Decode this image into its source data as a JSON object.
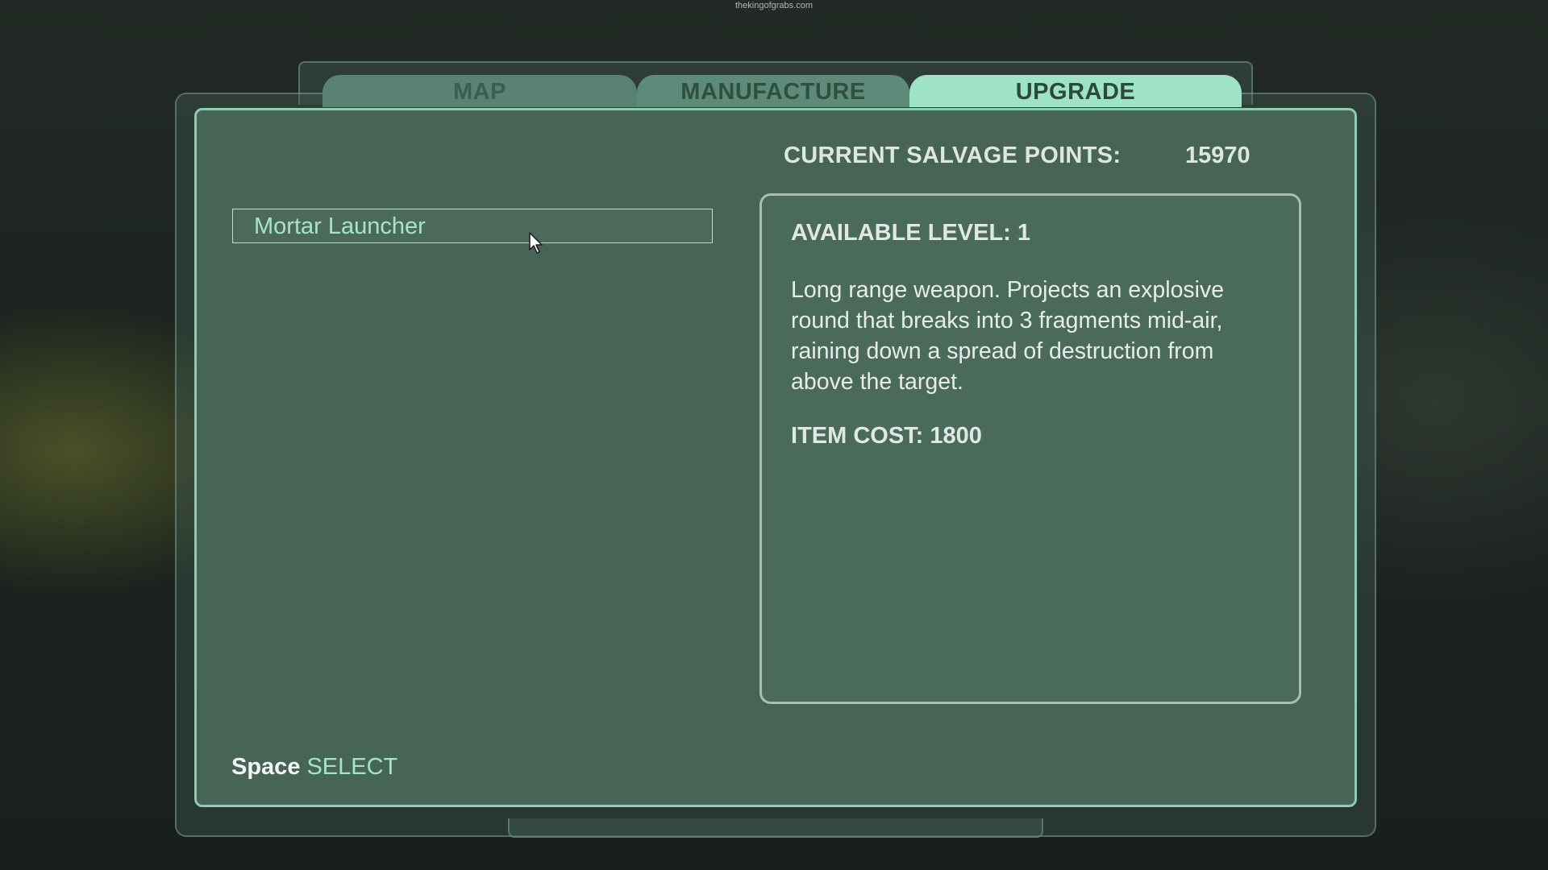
{
  "watermark": "thekingofgrabs.com",
  "tabs": [
    {
      "label": "MAP",
      "active": false
    },
    {
      "label": "MANUFACTURE",
      "active": false
    },
    {
      "label": "UPGRADE",
      "active": true
    }
  ],
  "salvage": {
    "label": "CURRENT SALVAGE POINTS:",
    "value": "15970"
  },
  "items": [
    {
      "label": "Mortar Launcher",
      "selected": true
    }
  ],
  "detail": {
    "level": "AVAILABLE LEVEL: 1",
    "description": "Long range weapon. Projects an explosive round that breaks into 3 fragments mid-air, raining down a spread of destruction from above the target.",
    "cost": "ITEM COST: 1800"
  },
  "footer": {
    "key": "Space",
    "action": "SELECT"
  },
  "colors": {
    "accent": "#a6e4ca",
    "active_tab": "#9fe3c7",
    "panel": "#466556",
    "panel_border": "#8fcab2"
  },
  "icons": {
    "cursor": "pointer-arrow-icon"
  }
}
